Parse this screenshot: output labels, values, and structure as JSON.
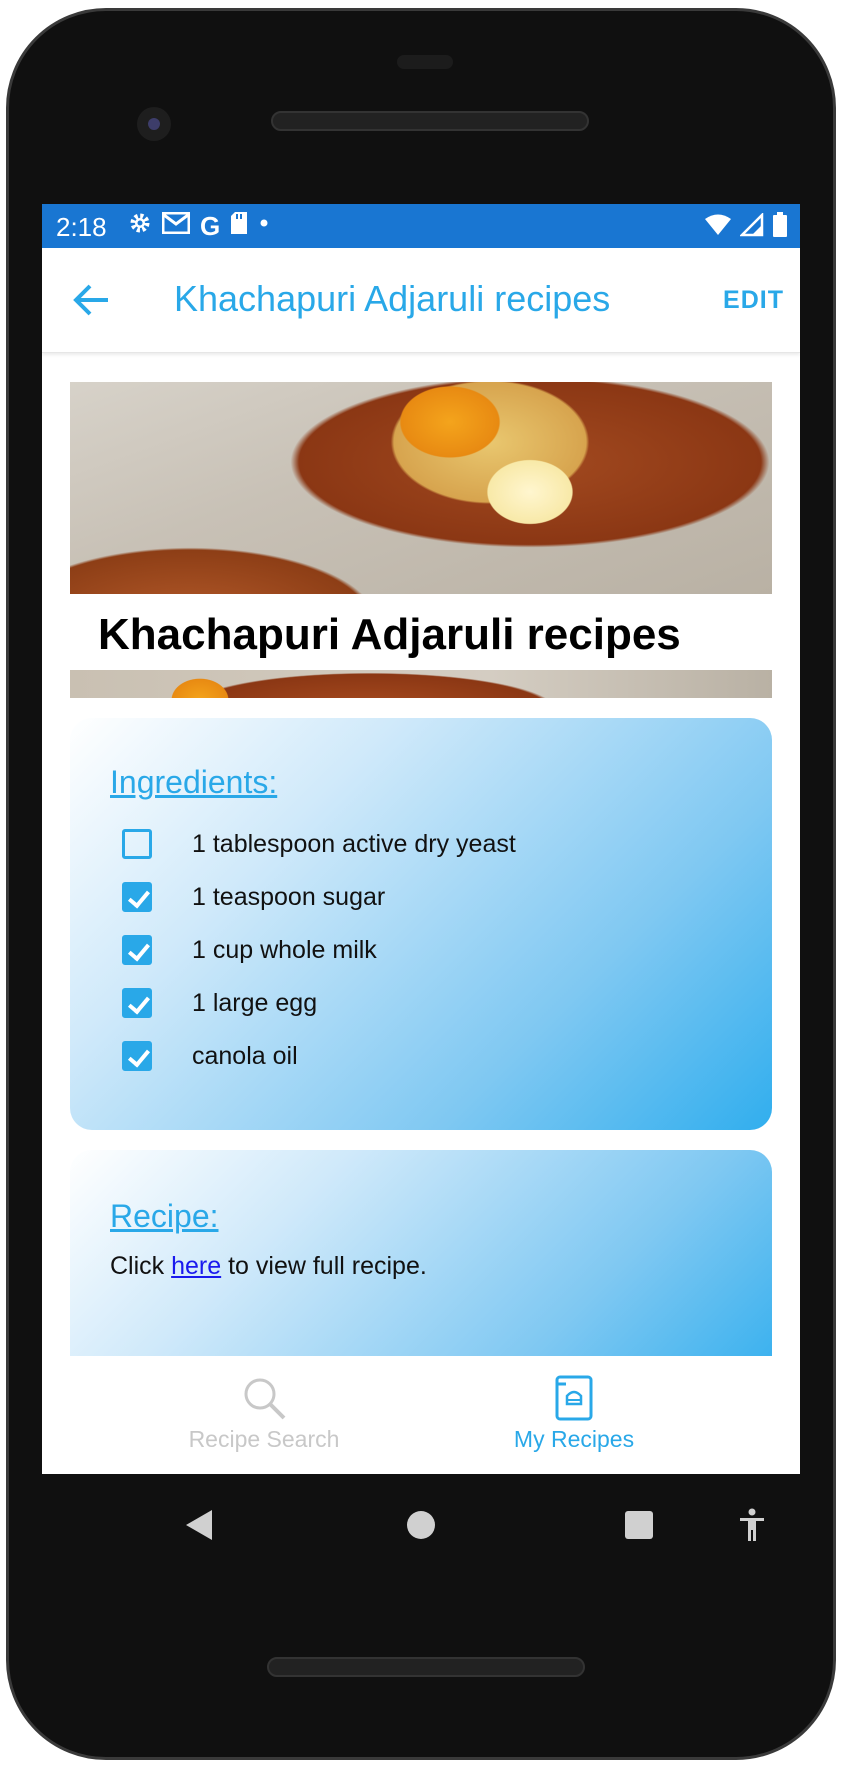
{
  "status_bar": {
    "time": "2:18",
    "left_icons": [
      "gear-icon",
      "gmail-icon",
      "google-icon",
      "sd-card-icon",
      "dot-icon"
    ],
    "right_icons": [
      "wifi-icon",
      "signal-icon",
      "battery-icon"
    ],
    "background_color": "#1976d2"
  },
  "app_bar": {
    "back_icon": "arrow-left-icon",
    "title": "Khachapuri Adjaruli recipes",
    "edit_label": "EDIT",
    "accent_color": "#29a8e8"
  },
  "recipe": {
    "heading": "Khachapuri Adjaruli recipes",
    "image": "khachapuri-photo"
  },
  "ingredients": {
    "title": "Ingredients:",
    "items": [
      {
        "label": "1 tablespoon active dry yeast",
        "checked": false
      },
      {
        "label": "1 teaspoon sugar",
        "checked": true
      },
      {
        "label": "1 cup whole milk",
        "checked": true
      },
      {
        "label": "1 large egg",
        "checked": true
      },
      {
        "label": "canola oil",
        "checked": true
      }
    ]
  },
  "recipe_card": {
    "title": "Recipe:",
    "text_before": "Click ",
    "link_text": "here",
    "text_after": " to view full recipe."
  },
  "bottom_nav": {
    "items": [
      {
        "label": "Recipe Search",
        "icon": "search-icon",
        "active": false
      },
      {
        "label": "My Recipes",
        "icon": "recipe-book-icon",
        "active": true
      }
    ]
  },
  "system_nav": {
    "buttons": [
      "back-triangle-icon",
      "home-circle-icon",
      "recents-square-icon",
      "accessibility-icon"
    ]
  }
}
